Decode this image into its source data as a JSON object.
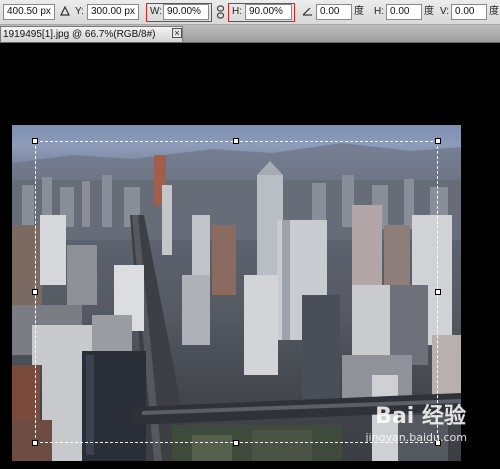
{
  "options_bar": {
    "x_value": "400.50 px",
    "y_label": "Y:",
    "y_value": "300.00 px",
    "w_label": "W:",
    "w_value": "90.00%",
    "h_label": "H:",
    "h_value": "90.00%",
    "angle_value": "0.00",
    "angle_unit": "度",
    "hskew_label": "H:",
    "hskew_value": "0.00",
    "hskew_unit": "度",
    "vskew_label": "V:",
    "vskew_value": "0.00",
    "vskew_unit": "度"
  },
  "document_tab": {
    "title": "1919495[1].jpg @ 66.7%(RGB/8#)",
    "close_glyph": "×"
  },
  "watermark": {
    "brand": "Bai  经验",
    "url": "jingyan.baidu.com"
  },
  "icons": [
    "delta-icon",
    "link-icon",
    "rotate-angle-icon",
    "close-icon"
  ]
}
